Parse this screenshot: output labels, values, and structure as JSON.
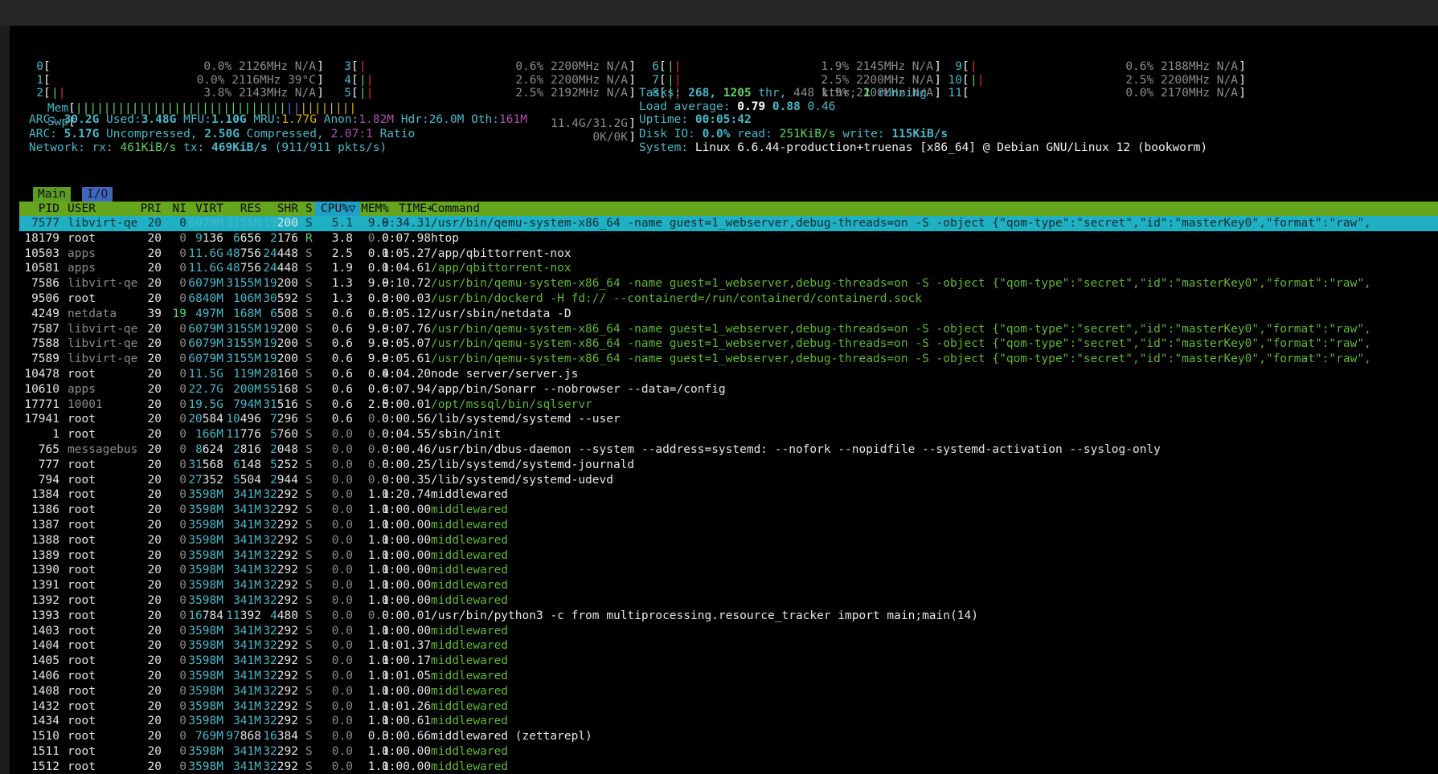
{
  "cpus_left": [
    {
      "label": "0",
      "bar": "",
      "value": "0.0% 2126MHz N/A"
    },
    {
      "label": "1",
      "bar": "",
      "value": "0.0% 2116MHz 39°C"
    },
    {
      "label": "2",
      "bar": "||",
      "value": "3.8% 2143MHz N/A"
    }
  ],
  "cpus_c2": [
    {
      "label": "3",
      "bar": "|",
      "value": "0.6% 2200MHz N/A"
    },
    {
      "label": "4",
      "bar": "||",
      "value": "2.6% 2200MHz N/A"
    },
    {
      "label": "5",
      "bar": "||",
      "value": "2.5% 2192MHz N/A"
    }
  ],
  "cpus_c3": [
    {
      "label": "6",
      "bar": "||",
      "value": "1.9% 2145MHz N/A"
    },
    {
      "label": "7",
      "bar": "||",
      "value": "2.5% 2200MHz N/A"
    },
    {
      "label": "8",
      "bar": "||",
      "value": "1.9% 2200MHz N/A"
    }
  ],
  "cpus_c4": [
    {
      "label": "9",
      "bar": "|",
      "value": "0.6% 2188MHz N/A"
    },
    {
      "label": "10",
      "bar": "||",
      "value": "2.5% 2200MHz N/A"
    },
    {
      "label": "11",
      "bar": "",
      "value": "0.0% 2170MHz N/A"
    }
  ],
  "mem": {
    "label": "Mem",
    "bar": "||||||||||||||||||||||||||||||||||||||||",
    "value": "11.4G/31.2G"
  },
  "swp": {
    "label": "Swp",
    "value": "0K/0K"
  },
  "arc1": {
    "label": "ARC:",
    "size": "30.2G",
    "used_l": "Used:",
    "used": "3.48G",
    "mfu_l": "MFU:",
    "mfu": "1.10G",
    "mru_l": "MRU:",
    "mru": "1.77G",
    "anon_l": "Anon:",
    "anon": "1.82M",
    "hdr_l": "Hdr:",
    "hdr": "26.0M",
    "oth_l": "Oth:",
    "oth": "161M"
  },
  "arc2": {
    "label": "ARC:",
    "uncomp": "5.17G",
    "uncomp_l": "Uncompressed,",
    "comp": "2.50G",
    "comp_l": "Compressed,",
    "ratio": "2.07:1",
    "ratio_l": "Ratio"
  },
  "network": {
    "label": "Network:",
    "rx_l": "rx:",
    "rx": "461KiB/s",
    "tx_l": "tx:",
    "tx": "469KiB/s",
    "pkts": "(911/911 pkts/s)"
  },
  "tasks": {
    "label": "Tasks:",
    "tasks": "268,",
    "thr": "1205",
    "thr_l": "thr,",
    "kthr": "448 kthr;",
    "running": "1",
    "running_l": "running"
  },
  "load": {
    "label": "Load average:",
    "l1": "0.79",
    "l5": "0.88",
    "l15": "0.46"
  },
  "uptime": {
    "label": "Uptime:",
    "value": "00:05:42"
  },
  "disk": {
    "label": "Disk IO:",
    "pct": "0.0%",
    "read_l": "read:",
    "read": "251KiB/s",
    "write_l": "write:",
    "write": "115KiB/s"
  },
  "system": {
    "label": "System:",
    "value": "Linux 6.6.44-production+truenas [x86_64] @ Debian GNU/Linux 12 (bookworm)"
  },
  "tabs": {
    "main": "Main",
    "io": "I/O"
  },
  "columns": {
    "pid": "PID",
    "user": "USER",
    "pri": "PRI",
    "ni": "NI",
    "virt": "VIRT",
    "res": "RES",
    "shr": "SHR",
    "s": "S",
    "cpu": "CPU%",
    "mem": "MEM%",
    "time": "TIME+",
    "cmd": "Command"
  },
  "processes": [
    {
      "pid": "7577",
      "user": "libvirt-qe",
      "pri": "20",
      "ni": "0",
      "virt": "6079M",
      "res": "3155M",
      "shr": "19200",
      "s": "S",
      "cpu": "5.1",
      "mem": "9.9",
      "time": "0:34.31",
      "cmd": "/usr/bin/qemu-system-x86_64 -name guest=1_webserver,debug-threads=on -S -object {\"qom-type\":\"secret\",\"id\":\"masterKey0\",\"format\":\"raw\",",
      "sel": true,
      "kind": "thread"
    },
    {
      "pid": "18179",
      "user": "root",
      "pri": "20",
      "ni": "0",
      "virt": "9136",
      "res": "6656",
      "shr": "2176",
      "s": "R",
      "cpu": "3.8",
      "mem": "0.0",
      "time": "0:07.98",
      "cmd": "htop",
      "kind": "proc"
    },
    {
      "pid": "10503",
      "user": "apps",
      "pri": "20",
      "ni": "0",
      "virt": "11.6G",
      "res": "48756",
      "shr": "24448",
      "s": "S",
      "cpu": "2.5",
      "mem": "0.1",
      "time": "0:05.27",
      "cmd": "/app/qbittorrent-nox",
      "kind": "proc"
    },
    {
      "pid": "10581",
      "user": "apps",
      "pri": "20",
      "ni": "0",
      "virt": "11.6G",
      "res": "48756",
      "shr": "24448",
      "s": "S",
      "cpu": "1.9",
      "mem": "0.1",
      "time": "0:04.61",
      "cmd": "/app/qbittorrent-nox",
      "kind": "thread"
    },
    {
      "pid": "7586",
      "user": "libvirt-qe",
      "pri": "20",
      "ni": "0",
      "virt": "6079M",
      "res": "3155M",
      "shr": "19200",
      "s": "S",
      "cpu": "1.3",
      "mem": "9.9",
      "time": "0:10.72",
      "cmd": "/usr/bin/qemu-system-x86_64 -name guest=1_webserver,debug-threads=on -S -object {\"qom-type\":\"secret\",\"id\":\"masterKey0\",\"format\":\"raw\",",
      "kind": "thread"
    },
    {
      "pid": "9506",
      "user": "root",
      "pri": "20",
      "ni": "0",
      "virt": "6840M",
      "res": "106M",
      "shr": "30592",
      "s": "S",
      "cpu": "1.3",
      "mem": "0.3",
      "time": "0:00.03",
      "cmd": "/usr/bin/dockerd -H fd:// --containerd=/run/containerd/containerd.sock",
      "kind": "thread"
    },
    {
      "pid": "4249",
      "user": "netdata",
      "pri": "39",
      "ni": "19",
      "virt": "497M",
      "res": "168M",
      "shr": "6508",
      "s": "S",
      "cpu": "0.6",
      "mem": "0.5",
      "time": "0:05.12",
      "cmd": "/usr/sbin/netdata -D",
      "kind": "proc"
    },
    {
      "pid": "7587",
      "user": "libvirt-qe",
      "pri": "20",
      "ni": "0",
      "virt": "6079M",
      "res": "3155M",
      "shr": "19200",
      "s": "S",
      "cpu": "0.6",
      "mem": "9.9",
      "time": "0:07.76",
      "cmd": "/usr/bin/qemu-system-x86_64 -name guest=1_webserver,debug-threads=on -S -object {\"qom-type\":\"secret\",\"id\":\"masterKey0\",\"format\":\"raw\",",
      "kind": "thread"
    },
    {
      "pid": "7588",
      "user": "libvirt-qe",
      "pri": "20",
      "ni": "0",
      "virt": "6079M",
      "res": "3155M",
      "shr": "19200",
      "s": "S",
      "cpu": "0.6",
      "mem": "9.9",
      "time": "0:05.07",
      "cmd": "/usr/bin/qemu-system-x86_64 -name guest=1_webserver,debug-threads=on -S -object {\"qom-type\":\"secret\",\"id\":\"masterKey0\",\"format\":\"raw\",",
      "kind": "thread"
    },
    {
      "pid": "7589",
      "user": "libvirt-qe",
      "pri": "20",
      "ni": "0",
      "virt": "6079M",
      "res": "3155M",
      "shr": "19200",
      "s": "S",
      "cpu": "0.6",
      "mem": "9.9",
      "time": "0:05.61",
      "cmd": "/usr/bin/qemu-system-x86_64 -name guest=1_webserver,debug-threads=on -S -object {\"qom-type\":\"secret\",\"id\":\"masterKey0\",\"format\":\"raw\",",
      "kind": "thread"
    },
    {
      "pid": "10478",
      "user": "root",
      "pri": "20",
      "ni": "0",
      "virt": "11.5G",
      "res": "119M",
      "shr": "28160",
      "s": "S",
      "cpu": "0.6",
      "mem": "0.4",
      "time": "0:04.20",
      "cmd": "node server/server.js",
      "kind": "proc"
    },
    {
      "pid": "10610",
      "user": "apps",
      "pri": "20",
      "ni": "0",
      "virt": "22.7G",
      "res": "200M",
      "shr": "55168",
      "s": "S",
      "cpu": "0.6",
      "mem": "0.6",
      "time": "0:07.94",
      "cmd": "/app/bin/Sonarr --nobrowser --data=/config",
      "kind": "proc"
    },
    {
      "pid": "17771",
      "user": "10001",
      "pri": "20",
      "ni": "0",
      "virt": "19.5G",
      "res": "794M",
      "shr": "31516",
      "s": "S",
      "cpu": "0.6",
      "mem": "2.5",
      "time": "0:00.01",
      "cmd": "/opt/mssql/bin/sqlservr",
      "kind": "thread"
    },
    {
      "pid": "17941",
      "user": "root",
      "pri": "20",
      "ni": "0",
      "virt": "20584",
      "res": "10496",
      "shr": "7296",
      "s": "S",
      "cpu": "0.6",
      "mem": "0.0",
      "time": "0:00.56",
      "cmd": "/lib/systemd/systemd --user",
      "kind": "proc"
    },
    {
      "pid": "1",
      "user": "root",
      "pri": "20",
      "ni": "0",
      "virt": "166M",
      "res": "11776",
      "shr": "5760",
      "s": "S",
      "cpu": "0.0",
      "mem": "0.0",
      "time": "0:04.55",
      "cmd": "/sbin/init",
      "kind": "proc"
    },
    {
      "pid": "765",
      "user": "messagebus",
      "pri": "20",
      "ni": "0",
      "virt": "8624",
      "res": "2816",
      "shr": "2048",
      "s": "S",
      "cpu": "0.0",
      "mem": "0.0",
      "time": "0:00.46",
      "cmd": "/usr/bin/dbus-daemon --system --address=systemd: --nofork --nopidfile --systemd-activation --syslog-only",
      "kind": "proc"
    },
    {
      "pid": "777",
      "user": "root",
      "pri": "20",
      "ni": "0",
      "virt": "31568",
      "res": "6148",
      "shr": "5252",
      "s": "S",
      "cpu": "0.0",
      "mem": "0.0",
      "time": "0:00.25",
      "cmd": "/lib/systemd/systemd-journald",
      "kind": "proc"
    },
    {
      "pid": "794",
      "user": "root",
      "pri": "20",
      "ni": "0",
      "virt": "27352",
      "res": "5504",
      "shr": "2944",
      "s": "S",
      "cpu": "0.0",
      "mem": "0.0",
      "time": "0:00.35",
      "cmd": "/lib/systemd/systemd-udevd",
      "kind": "proc"
    },
    {
      "pid": "1384",
      "user": "root",
      "pri": "20",
      "ni": "0",
      "virt": "3598M",
      "res": "341M",
      "shr": "32292",
      "s": "S",
      "cpu": "0.0",
      "mem": "1.1",
      "time": "0:20.74",
      "cmd": "middlewared",
      "kind": "proc"
    },
    {
      "pid": "1386",
      "user": "root",
      "pri": "20",
      "ni": "0",
      "virt": "3598M",
      "res": "341M",
      "shr": "32292",
      "s": "S",
      "cpu": "0.0",
      "mem": "1.1",
      "time": "0:00.00",
      "cmd": "middlewared",
      "kind": "thread"
    },
    {
      "pid": "1387",
      "user": "root",
      "pri": "20",
      "ni": "0",
      "virt": "3598M",
      "res": "341M",
      "shr": "32292",
      "s": "S",
      "cpu": "0.0",
      "mem": "1.1",
      "time": "0:00.00",
      "cmd": "middlewared",
      "kind": "thread"
    },
    {
      "pid": "1388",
      "user": "root",
      "pri": "20",
      "ni": "0",
      "virt": "3598M",
      "res": "341M",
      "shr": "32292",
      "s": "S",
      "cpu": "0.0",
      "mem": "1.1",
      "time": "0:00.00",
      "cmd": "middlewared",
      "kind": "thread"
    },
    {
      "pid": "1389",
      "user": "root",
      "pri": "20",
      "ni": "0",
      "virt": "3598M",
      "res": "341M",
      "shr": "32292",
      "s": "S",
      "cpu": "0.0",
      "mem": "1.1",
      "time": "0:00.00",
      "cmd": "middlewared",
      "kind": "thread"
    },
    {
      "pid": "1390",
      "user": "root",
      "pri": "20",
      "ni": "0",
      "virt": "3598M",
      "res": "341M",
      "shr": "32292",
      "s": "S",
      "cpu": "0.0",
      "mem": "1.1",
      "time": "0:00.00",
      "cmd": "middlewared",
      "kind": "thread"
    },
    {
      "pid": "1391",
      "user": "root",
      "pri": "20",
      "ni": "0",
      "virt": "3598M",
      "res": "341M",
      "shr": "32292",
      "s": "S",
      "cpu": "0.0",
      "mem": "1.1",
      "time": "0:00.00",
      "cmd": "middlewared",
      "kind": "thread"
    },
    {
      "pid": "1392",
      "user": "root",
      "pri": "20",
      "ni": "0",
      "virt": "3598M",
      "res": "341M",
      "shr": "32292",
      "s": "S",
      "cpu": "0.0",
      "mem": "1.1",
      "time": "0:00.00",
      "cmd": "middlewared",
      "kind": "thread"
    },
    {
      "pid": "1393",
      "user": "root",
      "pri": "20",
      "ni": "0",
      "virt": "16784",
      "res": "11392",
      "shr": "4480",
      "s": "S",
      "cpu": "0.0",
      "mem": "0.0",
      "time": "0:00.01",
      "cmd": "/usr/bin/python3 -c from multiprocessing.resource_tracker import main;main(14)",
      "kind": "proc"
    },
    {
      "pid": "1403",
      "user": "root",
      "pri": "20",
      "ni": "0",
      "virt": "3598M",
      "res": "341M",
      "shr": "32292",
      "s": "S",
      "cpu": "0.0",
      "mem": "1.1",
      "time": "0:00.00",
      "cmd": "middlewared",
      "kind": "thread"
    },
    {
      "pid": "1404",
      "user": "root",
      "pri": "20",
      "ni": "0",
      "virt": "3598M",
      "res": "341M",
      "shr": "32292",
      "s": "S",
      "cpu": "0.0",
      "mem": "1.1",
      "time": "0:01.37",
      "cmd": "middlewared",
      "kind": "thread"
    },
    {
      "pid": "1405",
      "user": "root",
      "pri": "20",
      "ni": "0",
      "virt": "3598M",
      "res": "341M",
      "shr": "32292",
      "s": "S",
      "cpu": "0.0",
      "mem": "1.1",
      "time": "0:00.17",
      "cmd": "middlewared",
      "kind": "thread"
    },
    {
      "pid": "1406",
      "user": "root",
      "pri": "20",
      "ni": "0",
      "virt": "3598M",
      "res": "341M",
      "shr": "32292",
      "s": "S",
      "cpu": "0.0",
      "mem": "1.1",
      "time": "0:01.05",
      "cmd": "middlewared",
      "kind": "thread"
    },
    {
      "pid": "1408",
      "user": "root",
      "pri": "20",
      "ni": "0",
      "virt": "3598M",
      "res": "341M",
      "shr": "32292",
      "s": "S",
      "cpu": "0.0",
      "mem": "1.1",
      "time": "0:00.00",
      "cmd": "middlewared",
      "kind": "thread"
    },
    {
      "pid": "1432",
      "user": "root",
      "pri": "20",
      "ni": "0",
      "virt": "3598M",
      "res": "341M",
      "shr": "32292",
      "s": "S",
      "cpu": "0.0",
      "mem": "1.1",
      "time": "0:01.26",
      "cmd": "middlewared",
      "kind": "thread"
    },
    {
      "pid": "1434",
      "user": "root",
      "pri": "20",
      "ni": "0",
      "virt": "3598M",
      "res": "341M",
      "shr": "32292",
      "s": "S",
      "cpu": "0.0",
      "mem": "1.1",
      "time": "0:00.61",
      "cmd": "middlewared",
      "kind": "thread"
    },
    {
      "pid": "1510",
      "user": "root",
      "pri": "20",
      "ni": "0",
      "virt": "769M",
      "res": "97868",
      "shr": "16384",
      "s": "S",
      "cpu": "0.0",
      "mem": "0.3",
      "time": "0:00.66",
      "cmd": "middlewared (zettarepl)",
      "kind": "proc"
    },
    {
      "pid": "1511",
      "user": "root",
      "pri": "20",
      "ni": "0",
      "virt": "3598M",
      "res": "341M",
      "shr": "32292",
      "s": "S",
      "cpu": "0.0",
      "mem": "1.1",
      "time": "0:00.00",
      "cmd": "middlewared",
      "kind": "thread"
    },
    {
      "pid": "1512",
      "user": "root",
      "pri": "20",
      "ni": "0",
      "virt": "3598M",
      "res": "341M",
      "shr": "32292",
      "s": "S",
      "cpu": "0.0",
      "mem": "1.1",
      "time": "0:00.00",
      "cmd": "middlewared",
      "kind": "thread"
    }
  ]
}
